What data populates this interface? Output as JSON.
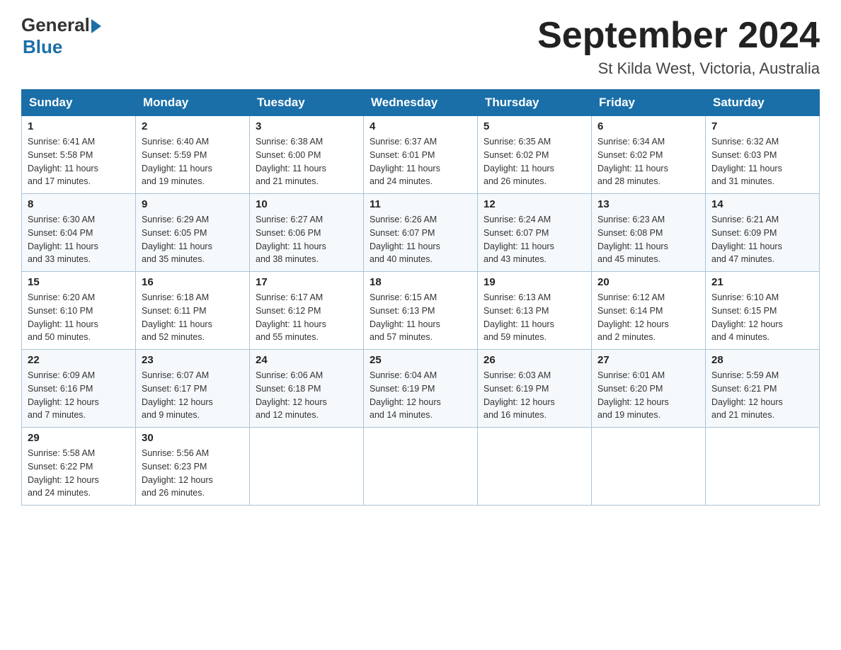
{
  "logo": {
    "general": "General",
    "blue": "Blue"
  },
  "title": "September 2024",
  "location": "St Kilda West, Victoria, Australia",
  "days_of_week": [
    "Sunday",
    "Monday",
    "Tuesday",
    "Wednesday",
    "Thursday",
    "Friday",
    "Saturday"
  ],
  "weeks": [
    [
      {
        "day": "1",
        "sunrise": "6:41 AM",
        "sunset": "5:58 PM",
        "daylight": "11 hours and 17 minutes."
      },
      {
        "day": "2",
        "sunrise": "6:40 AM",
        "sunset": "5:59 PM",
        "daylight": "11 hours and 19 minutes."
      },
      {
        "day": "3",
        "sunrise": "6:38 AM",
        "sunset": "6:00 PM",
        "daylight": "11 hours and 21 minutes."
      },
      {
        "day": "4",
        "sunrise": "6:37 AM",
        "sunset": "6:01 PM",
        "daylight": "11 hours and 24 minutes."
      },
      {
        "day": "5",
        "sunrise": "6:35 AM",
        "sunset": "6:02 PM",
        "daylight": "11 hours and 26 minutes."
      },
      {
        "day": "6",
        "sunrise": "6:34 AM",
        "sunset": "6:02 PM",
        "daylight": "11 hours and 28 minutes."
      },
      {
        "day": "7",
        "sunrise": "6:32 AM",
        "sunset": "6:03 PM",
        "daylight": "11 hours and 31 minutes."
      }
    ],
    [
      {
        "day": "8",
        "sunrise": "6:30 AM",
        "sunset": "6:04 PM",
        "daylight": "11 hours and 33 minutes."
      },
      {
        "day": "9",
        "sunrise": "6:29 AM",
        "sunset": "6:05 PM",
        "daylight": "11 hours and 35 minutes."
      },
      {
        "day": "10",
        "sunrise": "6:27 AM",
        "sunset": "6:06 PM",
        "daylight": "11 hours and 38 minutes."
      },
      {
        "day": "11",
        "sunrise": "6:26 AM",
        "sunset": "6:07 PM",
        "daylight": "11 hours and 40 minutes."
      },
      {
        "day": "12",
        "sunrise": "6:24 AM",
        "sunset": "6:07 PM",
        "daylight": "11 hours and 43 minutes."
      },
      {
        "day": "13",
        "sunrise": "6:23 AM",
        "sunset": "6:08 PM",
        "daylight": "11 hours and 45 minutes."
      },
      {
        "day": "14",
        "sunrise": "6:21 AM",
        "sunset": "6:09 PM",
        "daylight": "11 hours and 47 minutes."
      }
    ],
    [
      {
        "day": "15",
        "sunrise": "6:20 AM",
        "sunset": "6:10 PM",
        "daylight": "11 hours and 50 minutes."
      },
      {
        "day": "16",
        "sunrise": "6:18 AM",
        "sunset": "6:11 PM",
        "daylight": "11 hours and 52 minutes."
      },
      {
        "day": "17",
        "sunrise": "6:17 AM",
        "sunset": "6:12 PM",
        "daylight": "11 hours and 55 minutes."
      },
      {
        "day": "18",
        "sunrise": "6:15 AM",
        "sunset": "6:13 PM",
        "daylight": "11 hours and 57 minutes."
      },
      {
        "day": "19",
        "sunrise": "6:13 AM",
        "sunset": "6:13 PM",
        "daylight": "11 hours and 59 minutes."
      },
      {
        "day": "20",
        "sunrise": "6:12 AM",
        "sunset": "6:14 PM",
        "daylight": "12 hours and 2 minutes."
      },
      {
        "day": "21",
        "sunrise": "6:10 AM",
        "sunset": "6:15 PM",
        "daylight": "12 hours and 4 minutes."
      }
    ],
    [
      {
        "day": "22",
        "sunrise": "6:09 AM",
        "sunset": "6:16 PM",
        "daylight": "12 hours and 7 minutes."
      },
      {
        "day": "23",
        "sunrise": "6:07 AM",
        "sunset": "6:17 PM",
        "daylight": "12 hours and 9 minutes."
      },
      {
        "day": "24",
        "sunrise": "6:06 AM",
        "sunset": "6:18 PM",
        "daylight": "12 hours and 12 minutes."
      },
      {
        "day": "25",
        "sunrise": "6:04 AM",
        "sunset": "6:19 PM",
        "daylight": "12 hours and 14 minutes."
      },
      {
        "day": "26",
        "sunrise": "6:03 AM",
        "sunset": "6:19 PM",
        "daylight": "12 hours and 16 minutes."
      },
      {
        "day": "27",
        "sunrise": "6:01 AM",
        "sunset": "6:20 PM",
        "daylight": "12 hours and 19 minutes."
      },
      {
        "day": "28",
        "sunrise": "5:59 AM",
        "sunset": "6:21 PM",
        "daylight": "12 hours and 21 minutes."
      }
    ],
    [
      {
        "day": "29",
        "sunrise": "5:58 AM",
        "sunset": "6:22 PM",
        "daylight": "12 hours and 24 minutes."
      },
      {
        "day": "30",
        "sunrise": "5:56 AM",
        "sunset": "6:23 PM",
        "daylight": "12 hours and 26 minutes."
      },
      null,
      null,
      null,
      null,
      null
    ]
  ],
  "labels": {
    "sunrise": "Sunrise:",
    "sunset": "Sunset:",
    "daylight": "Daylight:"
  }
}
